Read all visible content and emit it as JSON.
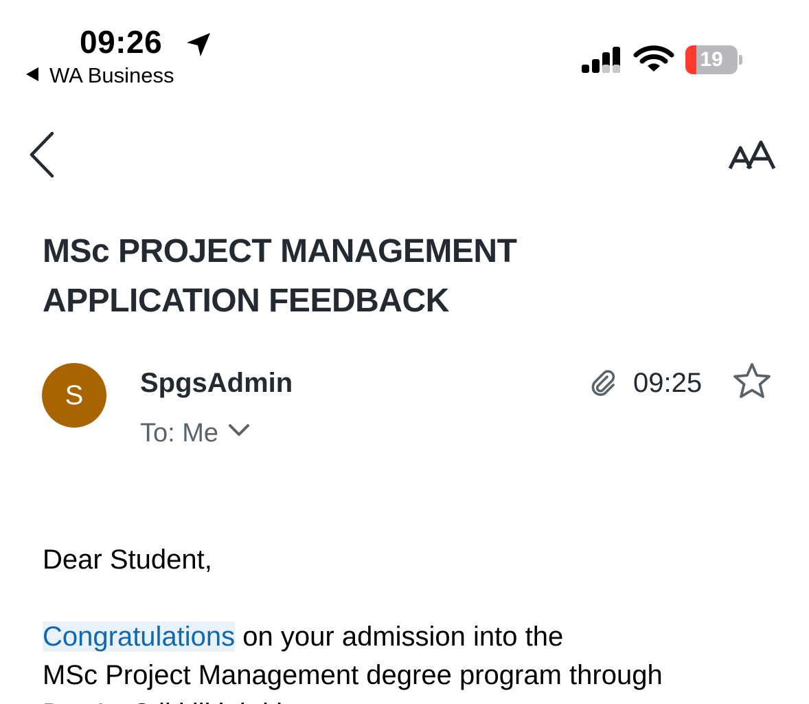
{
  "status_bar": {
    "time": "09:26",
    "back_app": "WA Business",
    "battery_level": "19",
    "battery_color": "#ff3b30",
    "icons": [
      "location-arrow-icon",
      "cellular-signal-icon",
      "wifi-icon",
      "battery-icon"
    ]
  },
  "nav": {
    "back_icon": "chevron-left-icon",
    "font_size_icon": "text-size-icon"
  },
  "email": {
    "subject_line1": "MSc PROJECT MANAGEMENT",
    "subject_line2": "APPLICATION FEEDBACK",
    "sender": {
      "initial": "S",
      "name": "SpgsAdmin",
      "avatar_color": "#a86400"
    },
    "recipients": "To: Me",
    "time": "09:25",
    "has_attachment": true,
    "body": {
      "greeting": "Dear Student,",
      "highlighted_word": "Congratulations",
      "line1_rest": " on your admission into the",
      "line2": "MSc Project Management degree program through",
      "line3_partial": "Dat                    A          t          C ll        l     lli  l  th      ith"
    }
  }
}
